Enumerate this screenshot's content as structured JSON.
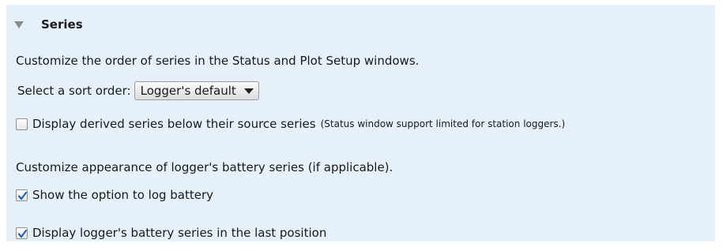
{
  "section": {
    "title": "Series"
  },
  "order": {
    "description": "Customize the order of series in the Status and Plot Setup windows.",
    "sort_label": "Select a sort order:",
    "sort_value": "Logger's default",
    "derived": {
      "label": "Display derived series below their source series",
      "note": "(Status window support limited for station loggers.)",
      "checked": false
    }
  },
  "battery": {
    "description": "Customize appearance of logger's battery series (if applicable).",
    "show_option": {
      "label": "Show the option to log battery",
      "checked": true
    },
    "last_position": {
      "label": "Display logger's battery series in the last position",
      "checked": true
    }
  },
  "colors": {
    "panel_bg": "#e6f0fb",
    "check_color": "#1f5fbf"
  }
}
